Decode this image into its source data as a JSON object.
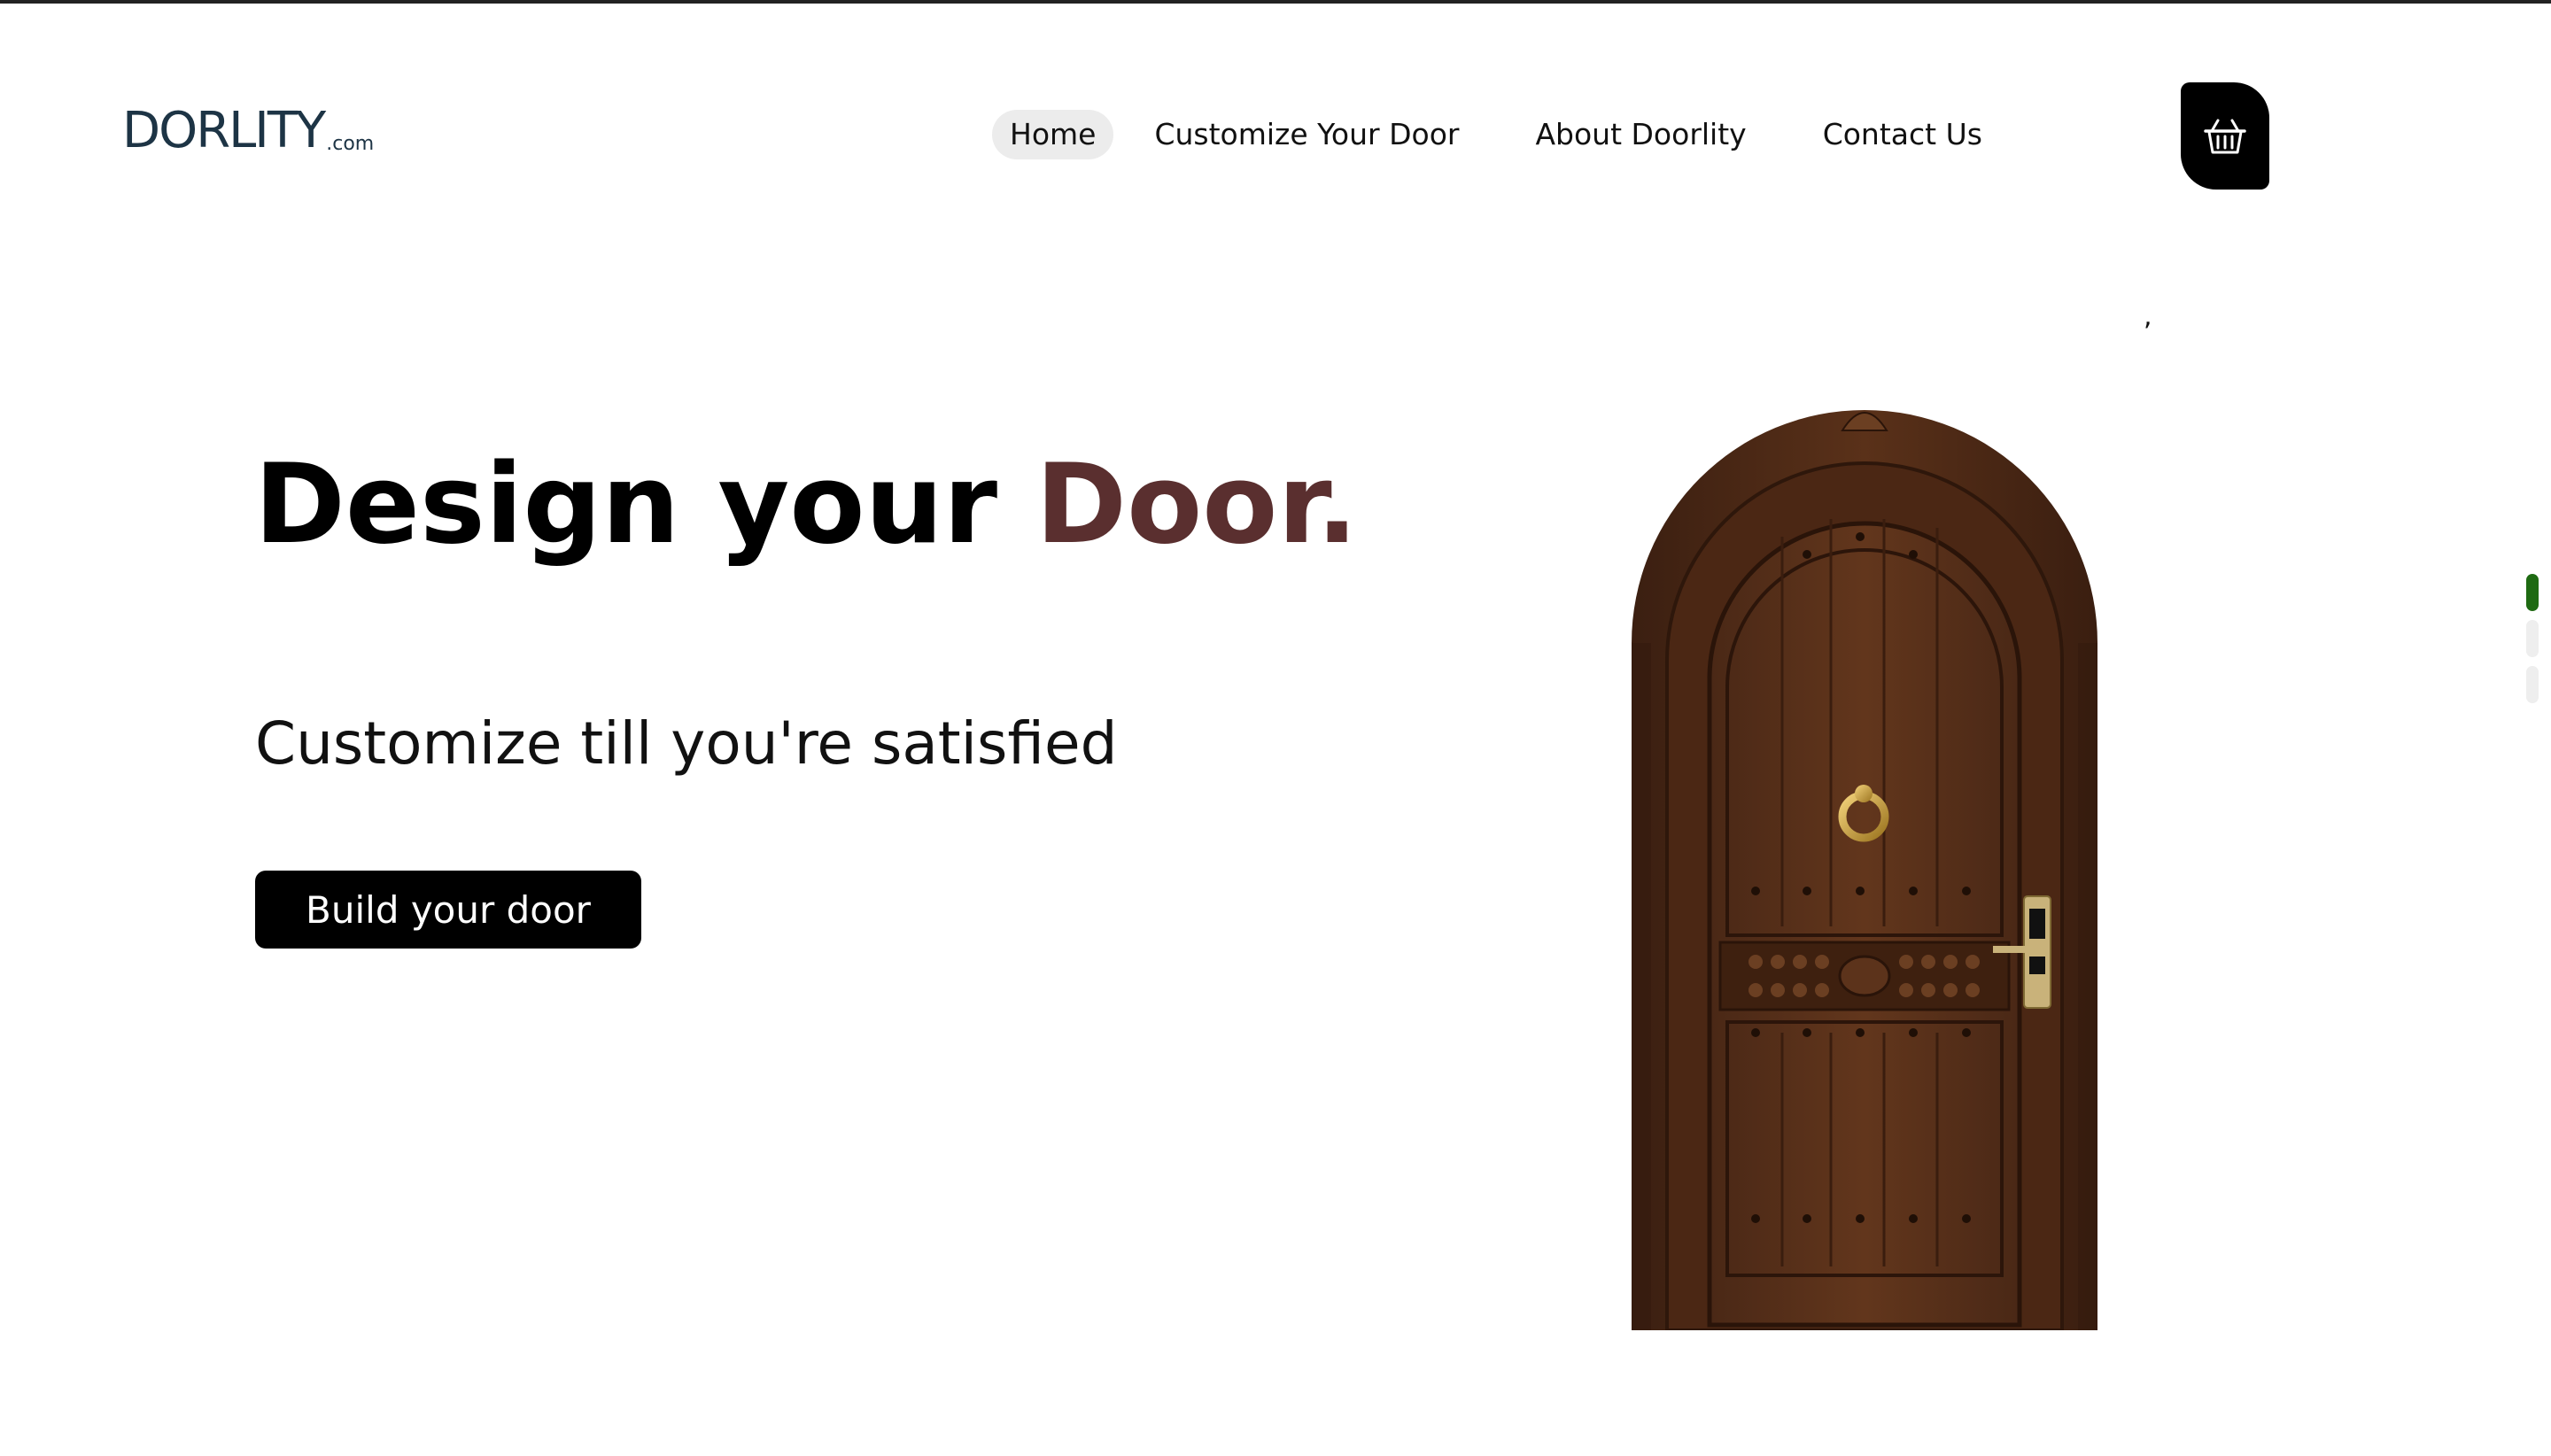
{
  "logo": {
    "text": "DORLITY",
    "suffix": ".com"
  },
  "nav": {
    "items": [
      {
        "label": "Home",
        "active": true
      },
      {
        "label": "Customize Your Door",
        "active": false
      },
      {
        "label": "About Doorlity",
        "active": false
      },
      {
        "label": "Contact Us",
        "active": false
      }
    ]
  },
  "cart": {
    "icon": "basket-icon"
  },
  "stray": ",",
  "hero": {
    "title_main": "Design your ",
    "title_accent": "Door.",
    "subtitle": "Customize till you're satisfied",
    "cta_label": "Build your door",
    "accent_color": "#5a2f2f"
  },
  "slides": {
    "count": 3,
    "active_index": 0,
    "active_color": "#1e6a12"
  }
}
